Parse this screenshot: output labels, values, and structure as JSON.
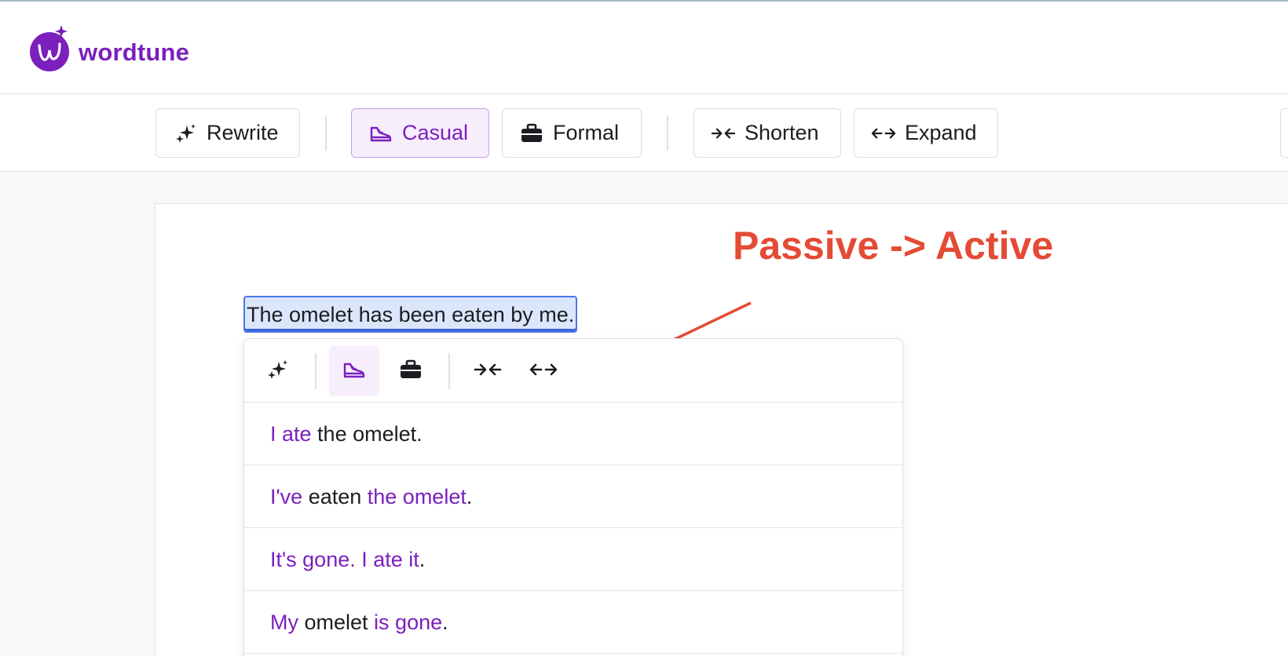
{
  "app": {
    "name": "wordtune"
  },
  "toolbar": {
    "rewrite_label": "Rewrite",
    "casual_label": "Casual",
    "formal_label": "Formal",
    "shorten_label": "Shorten",
    "expand_label": "Expand",
    "active": "Casual"
  },
  "editor": {
    "selected_sentence": "The omelet has been eaten by me."
  },
  "annotation": {
    "text": "Passive -> Active",
    "color": "#e34b35"
  },
  "suggestions": [
    {
      "parts": [
        {
          "text": "I ate",
          "hl": true
        },
        {
          "text": " the omelet.",
          "hl": false
        }
      ]
    },
    {
      "parts": [
        {
          "text": "I've",
          "hl": true
        },
        {
          "text": " eaten ",
          "hl": false
        },
        {
          "text": "the omelet",
          "hl": true
        },
        {
          "text": ".",
          "hl": false
        }
      ]
    },
    {
      "parts": [
        {
          "text": "It's gone. I ate it",
          "hl": true
        },
        {
          "text": ".",
          "hl": false
        }
      ]
    },
    {
      "parts": [
        {
          "text": "My",
          "hl": true
        },
        {
          "text": " omelet ",
          "hl": false
        },
        {
          "text": "is gone",
          "hl": true
        },
        {
          "text": ".",
          "hl": false
        }
      ]
    }
  ],
  "icons": {
    "rewrite": "sparkles-icon",
    "casual": "sneaker-icon",
    "formal": "briefcase-icon",
    "shorten": "arrows-in-icon",
    "expand": "arrows-out-icon"
  },
  "colors": {
    "brand": "#7b1fbd",
    "active_bg": "#f7eefc",
    "selection": "#dbe6fb",
    "annotation": "#e34b35"
  }
}
